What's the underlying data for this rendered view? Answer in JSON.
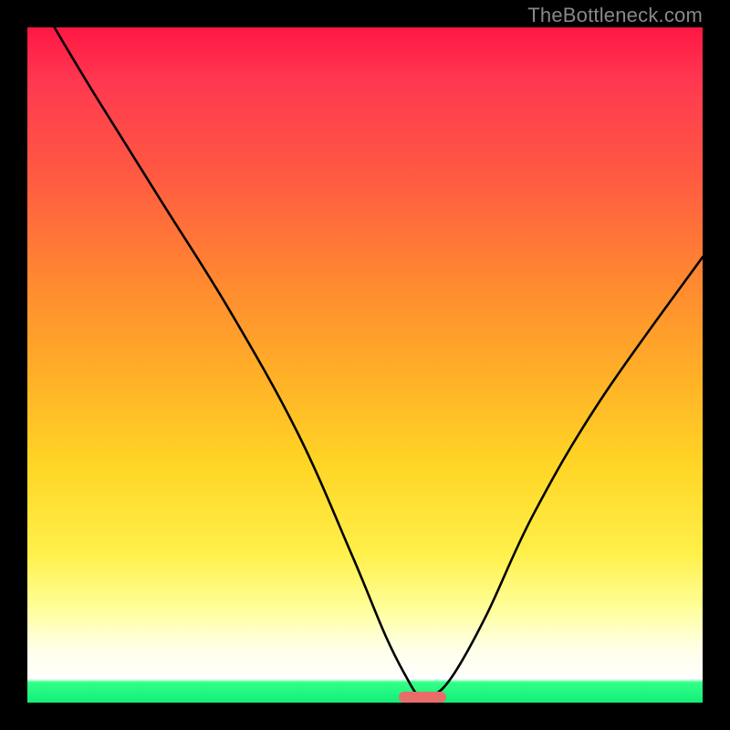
{
  "watermark": "TheBottleneck.com",
  "chart_data": {
    "type": "line",
    "title": "",
    "xlabel": "",
    "ylabel": "",
    "xlim": [
      0,
      100
    ],
    "ylim": [
      0,
      100
    ],
    "grid": false,
    "legend": false,
    "series": [
      {
        "name": "bottleneck-curve",
        "x": [
          4,
          10,
          20,
          30,
          40,
          48,
          53,
          56,
          58,
          60,
          63,
          68,
          75,
          85,
          100
        ],
        "y": [
          100,
          90,
          74,
          58,
          40,
          22,
          10,
          4,
          1,
          1,
          4,
          13,
          28,
          45,
          66
        ]
      }
    ],
    "optimum_marker": {
      "x_start": 55,
      "x_end": 62,
      "color": "#e86d6a"
    },
    "background_gradient": {
      "top": "#ff1744",
      "mid": "#ffd626",
      "low": "#ffffff",
      "bottom": "#11ee77"
    }
  }
}
